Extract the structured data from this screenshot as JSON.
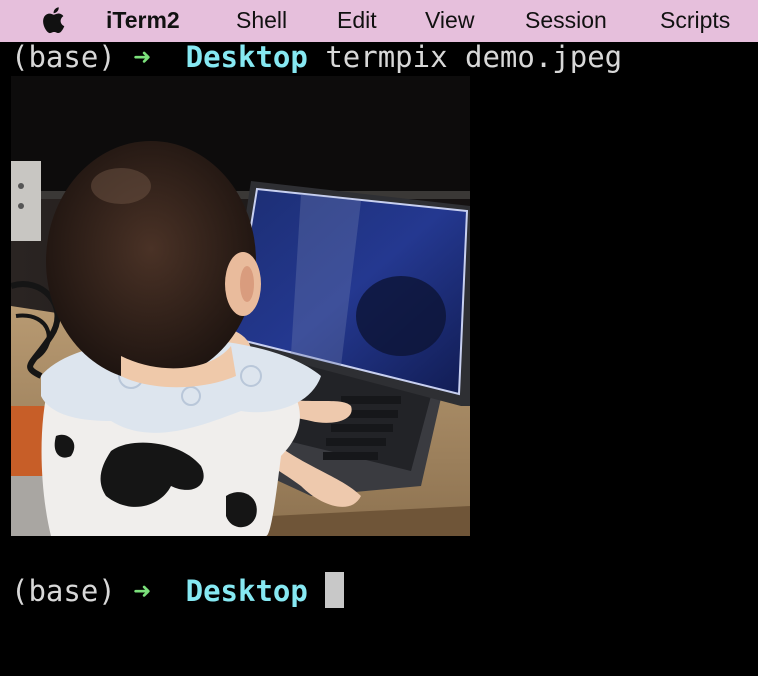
{
  "menubar": {
    "apple_icon": "apple-logo-icon",
    "items": [
      "iTerm2",
      "Shell",
      "Edit",
      "View",
      "Session",
      "Scripts"
    ]
  },
  "terminal": {
    "line1": {
      "env": "(base)",
      "arrow": "➜",
      "dir": "Desktop",
      "command": "termpix demo.jpeg"
    },
    "line2": {
      "env": "(base)",
      "arrow": "➜",
      "dir": "Desktop"
    }
  },
  "colors": {
    "menubar_bg": "#e6bfdc",
    "terminal_bg": "#000000",
    "arrow": "#7be07b",
    "directory": "#86e8f2",
    "text": "#d8d8d8",
    "cursor": "#c8c8c8"
  }
}
